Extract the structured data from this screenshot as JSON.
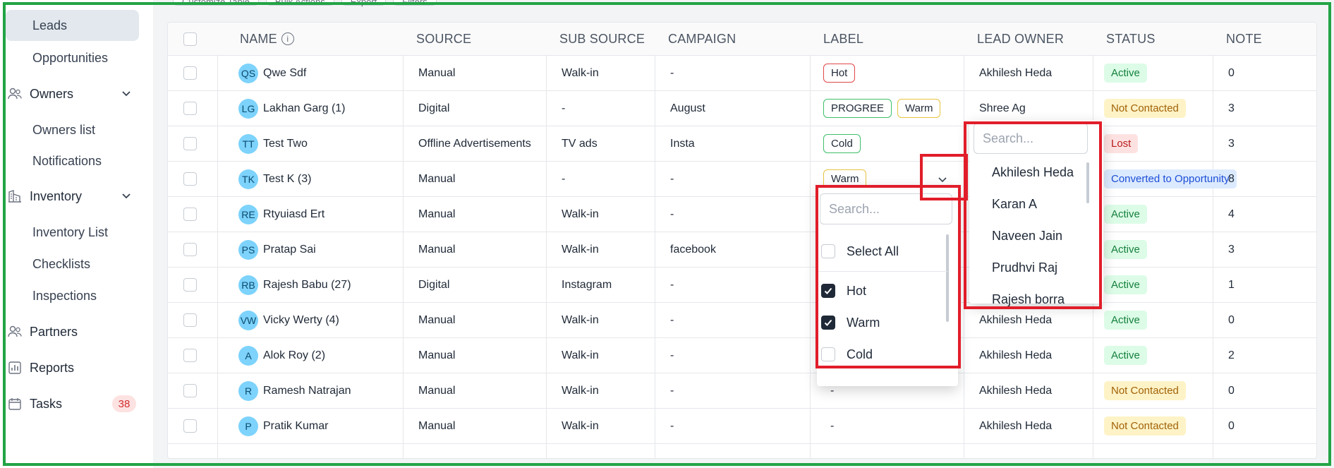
{
  "sidebar": {
    "items": [
      {
        "label": "Leads",
        "icon": "",
        "active": true,
        "type": "sub"
      },
      {
        "label": "Opportunities",
        "icon": "",
        "active": false,
        "type": "sub"
      },
      {
        "label": "Owners",
        "icon": "people-icon",
        "active": false,
        "type": "group"
      },
      {
        "label": "Owners list",
        "icon": "",
        "active": false,
        "type": "sub"
      },
      {
        "label": "Notifications",
        "icon": "",
        "active": false,
        "type": "sub"
      },
      {
        "label": "Inventory",
        "icon": "building-icon",
        "active": false,
        "type": "group"
      },
      {
        "label": "Inventory List",
        "icon": "",
        "active": false,
        "type": "sub"
      },
      {
        "label": "Checklists",
        "icon": "",
        "active": false,
        "type": "sub"
      },
      {
        "label": "Inspections",
        "icon": "",
        "active": false,
        "type": "sub"
      },
      {
        "label": "Partners",
        "icon": "people-icon",
        "active": false,
        "type": "group"
      },
      {
        "label": "Reports",
        "icon": "bar-chart-icon",
        "active": false,
        "type": "group"
      },
      {
        "label": "Tasks",
        "icon": "calendar-icon",
        "active": false,
        "type": "group",
        "badge": "38"
      }
    ]
  },
  "toolbar": {
    "buttons": [
      "Customize Table",
      "Bulk Actions",
      "Export",
      "Filters"
    ]
  },
  "table": {
    "columns": [
      "NAME",
      "SOURCE",
      "SUB SOURCE",
      "CAMPAIGN",
      "LABEL",
      "LEAD OWNER",
      "STATUS",
      "NOTE"
    ],
    "rows": [
      {
        "initials": "QS",
        "name": "Qwe Sdf",
        "source": "Manual",
        "sub_source": "Walk-in",
        "campaign": "-",
        "labels": [
          {
            "text": "Hot",
            "color": "red"
          }
        ],
        "owner": "Akhilesh Heda",
        "status": "Active",
        "status_kind": "active",
        "notes": "0"
      },
      {
        "initials": "LG",
        "name": "Lakhan Garg (1)",
        "source": "Digital",
        "sub_source": "-",
        "campaign": "August",
        "labels": [
          {
            "text": "PROGREE",
            "color": "green"
          },
          {
            "text": "Warm",
            "color": "yellow"
          }
        ],
        "owner": "Shree Ag",
        "status": "Not Contacted",
        "status_kind": "notc",
        "notes": "3"
      },
      {
        "initials": "TT",
        "name": "Test Two",
        "source": "Offline Advertisements",
        "sub_source": "TV ads",
        "campaign": "Insta",
        "labels": [
          {
            "text": "Cold",
            "color": "green"
          }
        ],
        "owner": "",
        "status": "Lost",
        "status_kind": "lost",
        "notes": "3"
      },
      {
        "initials": "TK",
        "name": "Test K (3)",
        "source": "Manual",
        "sub_source": "-",
        "campaign": "-",
        "labels": [
          {
            "text": "Warm",
            "color": "yellow"
          }
        ],
        "owner": "",
        "status": "Converted to Opportunity",
        "status_kind": "conv",
        "notes": "8"
      },
      {
        "initials": "RE",
        "name": "Rtyuiasd Ert",
        "source": "Manual",
        "sub_source": "Walk-in",
        "campaign": "-",
        "labels": [],
        "owner": "",
        "status": "Active",
        "status_kind": "active",
        "notes": "4"
      },
      {
        "initials": "PS",
        "name": "Pratap Sai",
        "source": "Manual",
        "sub_source": "Walk-in",
        "campaign": "facebook",
        "labels": [],
        "owner": "",
        "status": "Active",
        "status_kind": "active",
        "notes": "3"
      },
      {
        "initials": "RB",
        "name": "Rajesh Babu (27)",
        "source": "Digital",
        "sub_source": "Instagram",
        "campaign": "-",
        "labels": [],
        "owner": "",
        "status": "Active",
        "status_kind": "active",
        "notes": "1"
      },
      {
        "initials": "VW",
        "name": "Vicky Werty (4)",
        "source": "Manual",
        "sub_source": "Walk-in",
        "campaign": "-",
        "labels": [],
        "owner": "Akhilesh Heda",
        "status": "Active",
        "status_kind": "active",
        "notes": "0"
      },
      {
        "initials": "A",
        "name": "Alok Roy (2)",
        "source": "Manual",
        "sub_source": "Walk-in",
        "campaign": "-",
        "labels": [],
        "owner": "Akhilesh Heda",
        "status": "Active",
        "status_kind": "active",
        "notes": "2"
      },
      {
        "initials": "R",
        "name": "Ramesh Natrajan",
        "source": "Manual",
        "sub_source": "Walk-in",
        "campaign": "-",
        "labels": [
          {
            "text": "-",
            "color": "none"
          }
        ],
        "owner": "Akhilesh Heda",
        "status": "Not Contacted",
        "status_kind": "notc",
        "notes": "0"
      },
      {
        "initials": "P",
        "name": "Pratik Kumar",
        "source": "Manual",
        "sub_source": "Walk-in",
        "campaign": "-",
        "labels": [
          {
            "text": "-",
            "color": "none"
          }
        ],
        "owner": "Akhilesh Heda",
        "status": "Not Contacted",
        "status_kind": "notc",
        "notes": "0"
      }
    ]
  },
  "label_dropdown": {
    "search_placeholder": "Search...",
    "options": [
      {
        "label": "Select All",
        "checked": false
      },
      {
        "label": "Hot",
        "checked": true
      },
      {
        "label": "Warm",
        "checked": true
      },
      {
        "label": "Cold",
        "checked": false
      }
    ]
  },
  "owner_dropdown": {
    "search_placeholder": "Search...",
    "options": [
      "Akhilesh Heda",
      "Karan A",
      "Naveen Jain",
      "Prudhvi Raj",
      "Rajesh borra"
    ]
  },
  "colors": {
    "frame": "#22a445",
    "highlight": "#e11d2a",
    "avatar": "#7dd3fc",
    "active_nav": "#e2e8ed"
  }
}
